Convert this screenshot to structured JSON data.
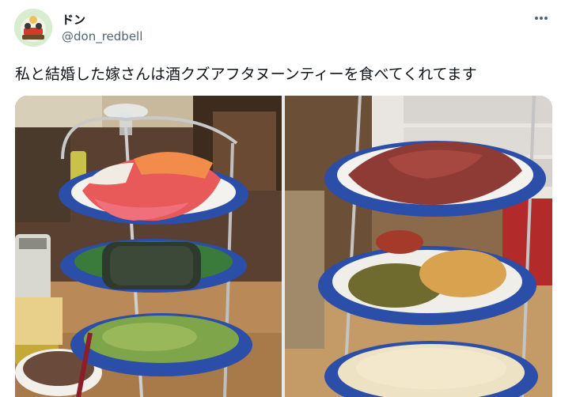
{
  "tweet": {
    "display_name": "ドン",
    "handle": "@don_redbell",
    "text": "私と結婚した嫁さんは酒クズアフタヌーンティーを食べてくれてます"
  },
  "icons": {
    "more": "more-horizontal-icon",
    "avatar": "avatar-illustration"
  },
  "colors": {
    "text_primary": "#0f1419",
    "text_secondary": "#536471",
    "plate_blue": "#2b4ea8"
  },
  "media": {
    "photos": [
      {
        "label": "afternoon-tea-stand-sashimi-tier"
      },
      {
        "label": "afternoon-tea-stand-roast-beef-tier"
      }
    ]
  }
}
